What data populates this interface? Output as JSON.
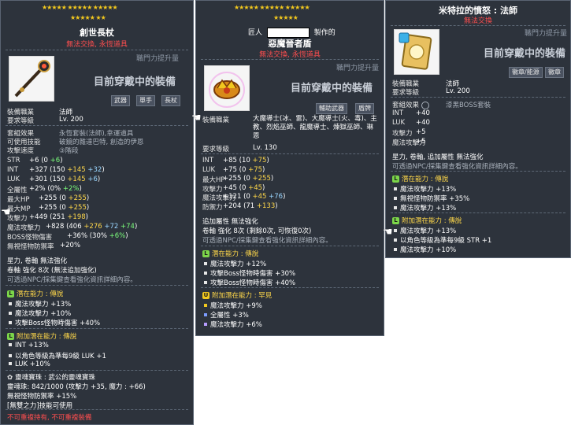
{
  "tip1": {
    "stars_row1": "★★★★★ ★★★★★ ★★★★★",
    "stars_row2": "★★★★★ ★★",
    "name": "創世長杖",
    "untradeable": "無法交換, 永恆道具",
    "upgrade_label": "職門力提升量",
    "equipped_label": "目前穿戴中的裝備",
    "chips": [
      "武器",
      "單手",
      "長杖"
    ],
    "info": [
      {
        "k": "裝備職業",
        "v": "法師"
      },
      {
        "k": "要求等級",
        "v": "Lv. 200"
      }
    ],
    "set": [
      {
        "k": "套組效果",
        "v": "永恆套裝(法師),幸運道具"
      },
      {
        "k": "可使用技能",
        "v": "破鏡的雜達巴特, 創造的伊恩"
      },
      {
        "k": "攻擊速度",
        "v": "③階段"
      }
    ],
    "stats": [
      {
        "k": "STR",
        "v": "+6",
        "b": "(0 ",
        "g": "+6",
        "e": ")"
      },
      {
        "k": "INT",
        "v": "+327",
        "b": "(150 ",
        "y": "+145",
        "c": " +32",
        "e": ")"
      },
      {
        "k": "LUK",
        "v": "+301",
        "b": "(150 ",
        "y": "+145",
        "c": " +6",
        "e": ")"
      },
      {
        "k": "全屬性",
        "v": "+2%",
        "b": "(0% ",
        "g": "+2%",
        "e": ")"
      },
      {
        "k": "最大HP",
        "v": "+255",
        "b": "(0 ",
        "y": "+255",
        "e": ")"
      },
      {
        "k": "最大MP",
        "v": "+255",
        "b": "(0 ",
        "y": "+255",
        "e": ")"
      },
      {
        "k": "攻擊力",
        "v": "+449",
        "b": "(251 ",
        "y": "+198",
        "e": ")"
      },
      {
        "k": "魔法攻擊力",
        "v": "+828",
        "b": "(406 ",
        "y": "+276",
        "c": " +72",
        "g": " +74",
        "e": ")"
      },
      {
        "k": "BOSS怪物傷害",
        "v": "+36%",
        "b": "(30% ",
        "g": "+6%",
        "e": ")"
      },
      {
        "k": "無視怪物防禦率",
        "v": "+20%"
      }
    ],
    "star_force": "星力, 卷軸 無法強化",
    "scroll": "卷軸 強化 8次 (無法追加強化)",
    "hint": "可透過NPC/採集鍵查看強化資訊詳細內容。",
    "potential_title": "潛在能力 : 傳說",
    "potential": [
      "魔法攻擊力 +13%",
      "魔法攻擊力 +10%",
      "攻擊Boss怪物時傷害 +40%"
    ],
    "addpot_title": "附加潛在能力 : 傳說",
    "addpot": [
      "INT +13%",
      "以角色等級為準每9級 LUK +1",
      "LUK +10%"
    ],
    "soul_title": "靈魂寶珠 : 武公的靈魂寶珠",
    "soul_line": "靈魂珠: 842/1000 (攻擊力 +35, 魔力 : +66)",
    "soul_def": "無視怪物防禦率 +15%",
    "soul_skill": "[無雙之力]技能可使用",
    "footer": "不可重複持有, 不可重複裝備"
  },
  "tip2": {
    "stars_row1": "★★★★★ ★★★★★ ★★★★★",
    "stars_row2": "★★★★★",
    "maker_prefix": "匠人",
    "maker_suffix": "製作的",
    "name": "惡魔晉者盾",
    "untradeable": "無法交換, 永恆道具",
    "upgrade_label": "職門力提升量",
    "equipped_label": "目前穿戴中的裝備",
    "chips": [
      "輔助武器",
      "盾牌"
    ],
    "job_label": "裝備職業",
    "job_value": "大魔導士(冰、雷)、大魔導士(火、毒)、主教、烈焰巫師、龍魔導士、煉獄巫師、琳恩",
    "req_label": "要求等級",
    "req_value": "Lv. 130",
    "stats": [
      {
        "k": "INT",
        "v": "+85",
        "b": "(10 ",
        "y": "+75",
        "e": ")"
      },
      {
        "k": "LUK",
        "v": "+75",
        "b": "(0 ",
        "y": "+75",
        "e": ")"
      },
      {
        "k": "最大HP",
        "v": "+255",
        "b": "(0 ",
        "y": "+255",
        "e": ")"
      },
      {
        "k": "攻擊力",
        "v": "+45",
        "b": "(0 ",
        "y": "+45",
        "e": ")"
      },
      {
        "k": "魔法攻擊力",
        "v": "+121",
        "b": "(0 ",
        "y": "+45",
        "c": " +76",
        "e": ")"
      },
      {
        "k": "防禦力",
        "v": "+204",
        "b": "(71 ",
        "y": "+133",
        "e": ")"
      }
    ],
    "extra": "追加屬性 無法強化",
    "scroll": "卷軸 強化 8次 (剩餘0次, 可恢復0次)",
    "hint": "可透過NPC/採集鍵查看強化資訊詳細內容。",
    "potential_title": "潛在能力 : 傳說",
    "potential": [
      "魔法攻擊力 +12%",
      "攻擊Boss怪物時傷害 +30%",
      "攻擊Boss怪物時傷害 +40%"
    ],
    "addpot_title": "附加潛在能力 : 罕見",
    "addpot": [
      "魔法攻擊力 +9%",
      "全屬性 +3%",
      "魔法攻擊力 +6%"
    ]
  },
  "tip3": {
    "name": "米特拉的憤怒 : 法師",
    "untradeable": "無法交換",
    "upgrade_label": "職門力提升量",
    "equipped_label": "目前穿戴中的裝備",
    "chips": [
      "徽章/能源",
      "徽章"
    ],
    "info": [
      {
        "k": "裝備職業",
        "v": "法師"
      },
      {
        "k": "要求等級",
        "v": "Lv. 200"
      },
      {
        "k": "套組效果",
        "v": "漆黑BOSS套裝"
      }
    ],
    "stats": [
      {
        "k": "INT",
        "v": "+40"
      },
      {
        "k": "LUK",
        "v": "+40"
      },
      {
        "k": "攻擊力",
        "v": "+5"
      },
      {
        "k": "魔法攻擊力",
        "v": "+5"
      }
    ],
    "star_force": "星力, 卷軸, 追加屬性 無法強化",
    "hint": "可透過NPC/採集鍵查看強化資訊詳細內容。",
    "potential_title": "潛在能力 : 傳說",
    "potential": [
      "魔法攻擊力 +13%",
      "無視怪物防禦率 +35%",
      "魔法攻擊力 +13%"
    ],
    "addpot_title": "附加潛在能力 : 傳說",
    "addpot": [
      "魔法攻擊力 +13%",
      "以角色等級為準每9級 STR +1",
      "魔法攻擊力 +10%"
    ]
  }
}
